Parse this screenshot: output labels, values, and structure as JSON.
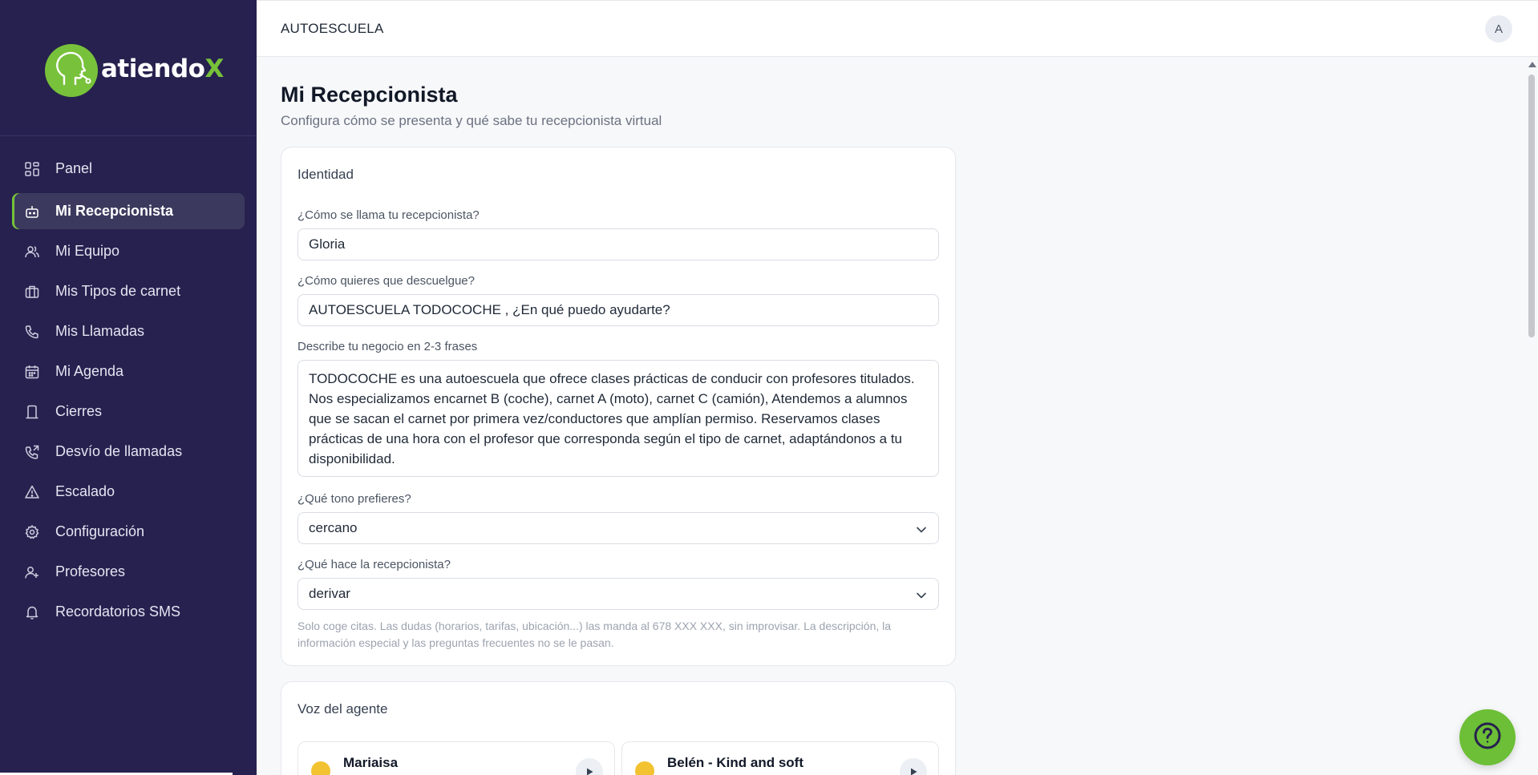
{
  "brand": {
    "name_prefix": "atiendo",
    "name_suffix": "X",
    "accent": "#77c23a",
    "sidebar_bg": "#27214f"
  },
  "topbar": {
    "org_name": "AUTOESCUELA",
    "avatar_initial": "A"
  },
  "sidebar": {
    "items": [
      {
        "label": "Panel",
        "icon": "grid-icon",
        "active": false
      },
      {
        "label": "Mi Recepcionista",
        "icon": "bot-icon",
        "active": true
      },
      {
        "label": "Mi Equipo",
        "icon": "users-icon",
        "active": false
      },
      {
        "label": "Mis Tipos de carnet",
        "icon": "briefcase-icon",
        "active": false
      },
      {
        "label": "Mis Llamadas",
        "icon": "phone-icon",
        "active": false
      },
      {
        "label": "Mi Agenda",
        "icon": "calendar-icon",
        "active": false
      },
      {
        "label": "Cierres",
        "icon": "door-icon",
        "active": false
      },
      {
        "label": "Desvío de llamadas",
        "icon": "phone-forward-icon",
        "active": false
      },
      {
        "label": "Escalado",
        "icon": "warning-icon",
        "active": false
      },
      {
        "label": "Configuración",
        "icon": "gear-icon",
        "active": false
      },
      {
        "label": "Profesores",
        "icon": "user-plus-icon",
        "active": false
      },
      {
        "label": "Recordatorios SMS",
        "icon": "bell-icon",
        "active": false
      }
    ]
  },
  "page": {
    "title": "Mi Recepcionista",
    "subtitle": "Configura cómo se presenta y qué sabe tu recepcionista virtual"
  },
  "identity": {
    "title": "Identidad",
    "name_label": "¿Cómo se llama tu recepcionista?",
    "name_value": "Gloria",
    "greeting_label": "¿Cómo quieres que descuelgue?",
    "greeting_value": "AUTOESCUELA TODOCOCHE , ¿En qué puedo ayudarte?",
    "description_label": "Describe tu negocio en 2-3 frases",
    "description_value": "TODOCOCHE es una autoescuela que ofrece clases prácticas de conducir con profesores titulados. Nos especializamos encarnet B (coche), carnet A (moto), carnet C (camión), Atendemos a alumnos que se sacan el carnet por primera vez/conductores que amplían permiso. Reservamos clases prácticas de una hora con el profesor que corresponda según el tipo de carnet, adaptándonos a tu disponibilidad.",
    "tone_label": "¿Qué tono prefieres?",
    "tone_value": "cercano",
    "role_label": "¿Qué hace la recepcionista?",
    "role_value": "derivar",
    "role_help": "Solo coge citas. Las dudas (horarios, tarifas, ubicación...) las manda al 678 XXX XXX, sin improvisar. La descripción, la información especial y las preguntas frecuentes no se le pasan."
  },
  "voice": {
    "title": "Voz del agente",
    "options": [
      {
        "name": "Mariaisa",
        "icon": "person-emoji-icon"
      },
      {
        "name": "Belén - Kind and soft",
        "icon": "person-emoji-icon"
      }
    ]
  }
}
